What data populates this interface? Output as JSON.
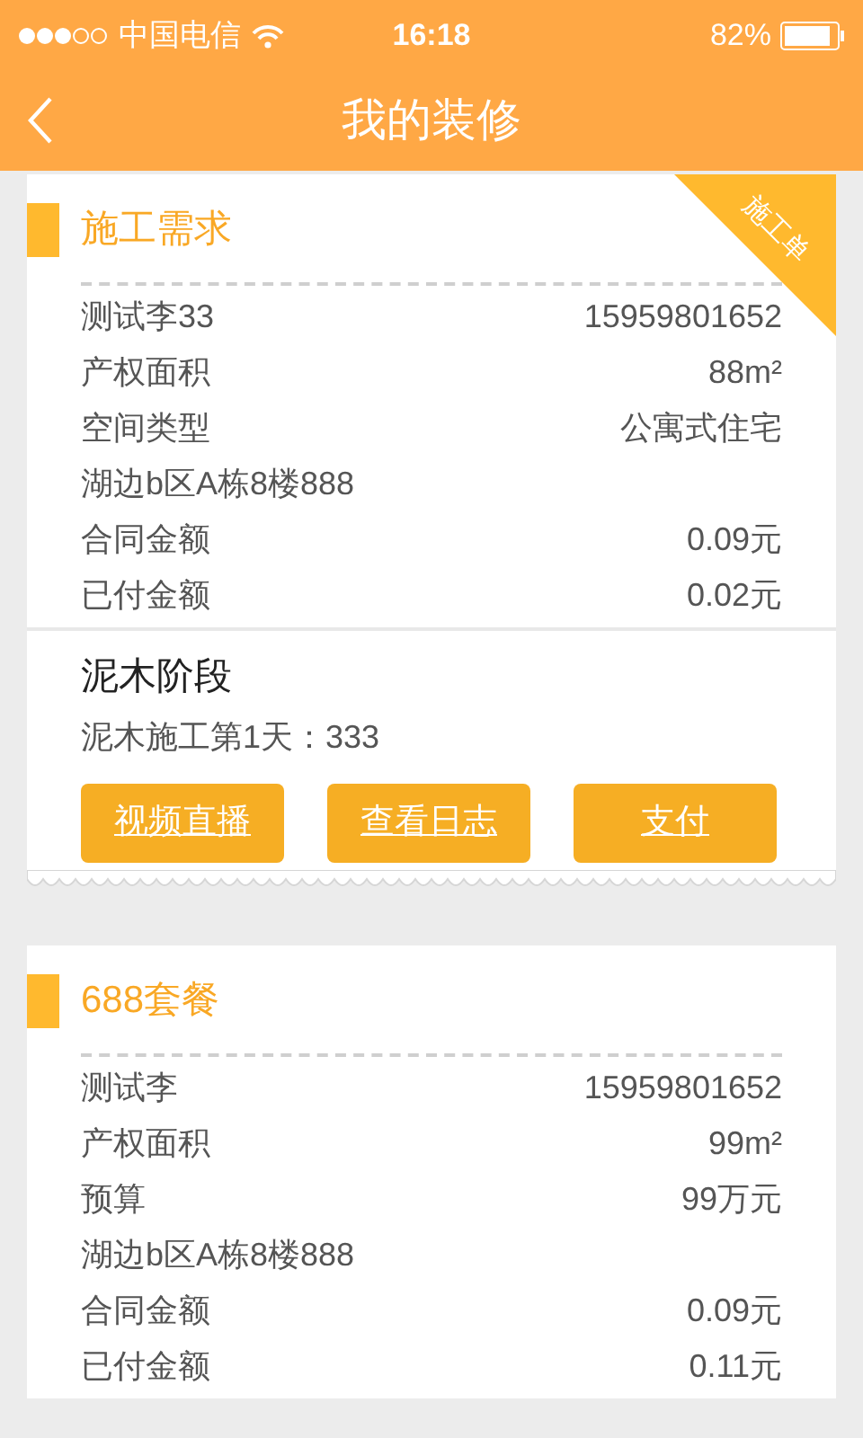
{
  "status_bar": {
    "carrier": "中国电信",
    "time": "16:18",
    "battery": "82%"
  },
  "nav": {
    "title": "我的装修"
  },
  "cards": [
    {
      "title": "施工需求",
      "ribbon": "施工单",
      "rows": [
        {
          "label": "测试李33",
          "value": "15959801652"
        },
        {
          "label": "产权面积",
          "value": "88m²"
        },
        {
          "label": "空间类型",
          "value": "公寓式住宅"
        },
        {
          "label": "湖边b区A栋8楼888"
        },
        {
          "label": "合同金额",
          "value": "0.09元"
        },
        {
          "label": "已付金额",
          "value": "0.02元"
        }
      ],
      "stage": {
        "title": "泥木阶段",
        "detail": "泥木施工第1天：333"
      },
      "buttons": [
        "视频直播",
        "查看日志",
        "支付"
      ]
    },
    {
      "title": "688套餐",
      "rows": [
        {
          "label": "测试李",
          "value": "15959801652"
        },
        {
          "label": "产权面积",
          "value": "99m²"
        },
        {
          "label": "预算",
          "value": "99万元"
        },
        {
          "label": "湖边b区A栋8楼888"
        },
        {
          "label": "合同金额",
          "value": "0.09元"
        },
        {
          "label": "已付金额",
          "value": "0.11元"
        }
      ]
    }
  ]
}
